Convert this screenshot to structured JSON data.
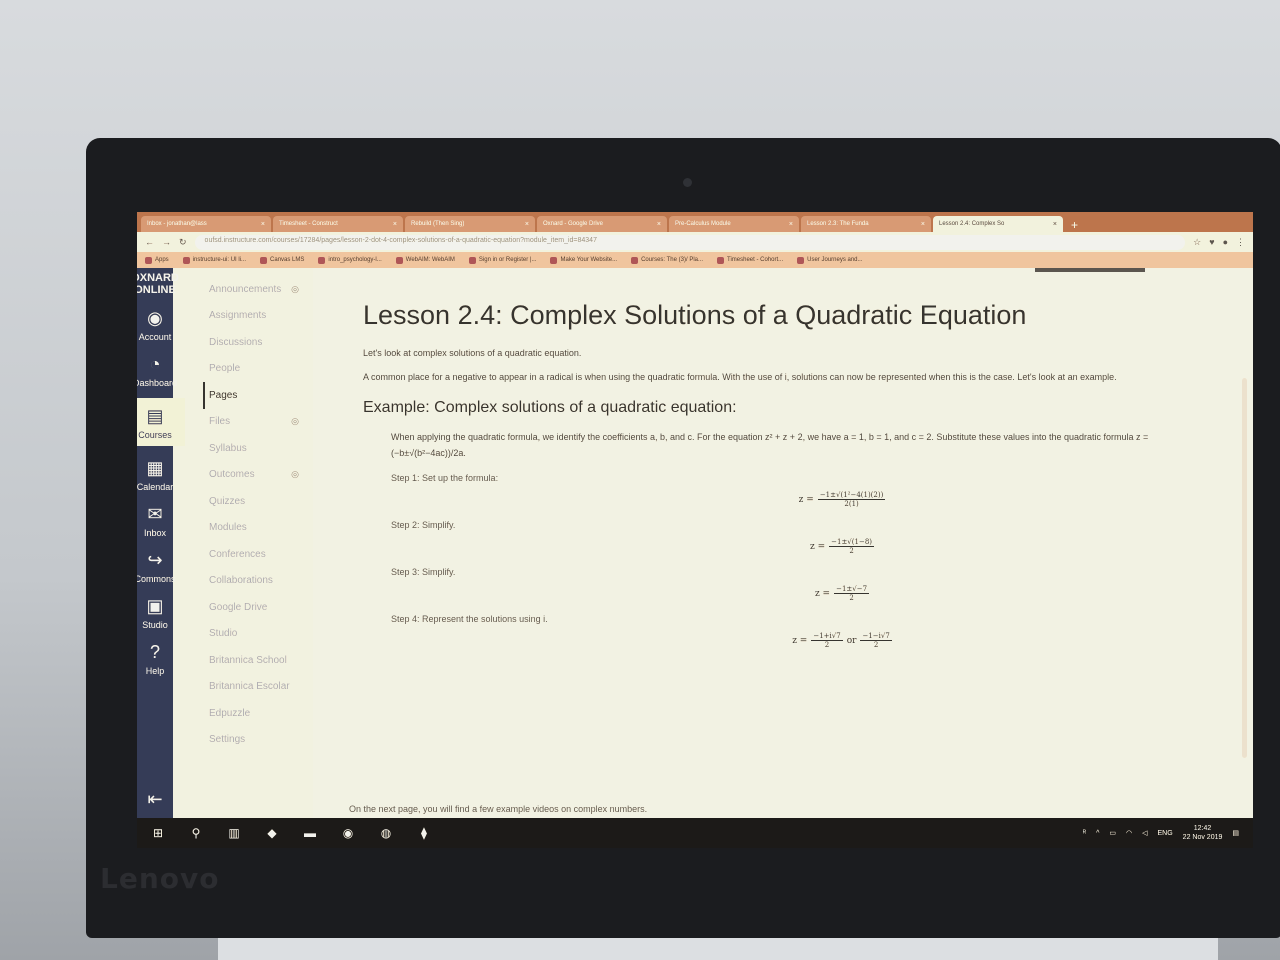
{
  "browser": {
    "tabs": [
      {
        "label": "Inbox - jonathan@lass",
        "active": false
      },
      {
        "label": "Timesheet - Construct",
        "active": false
      },
      {
        "label": "Rebuild (Then Sing)",
        "active": false
      },
      {
        "label": "Oxnard - Google Drive",
        "active": false
      },
      {
        "label": "Pre-Calculus Module",
        "active": false
      },
      {
        "label": "Lesson 2.3: The Funda",
        "active": false
      },
      {
        "label": "Lesson 2.4: Complex So",
        "active": true
      }
    ],
    "url": "oufsd.instructure.com/courses/17284/pages/lesson-2-dot-4-complex-solutions-of-a-quadratic-equation?module_item_id=84347",
    "bookmarks": [
      "Apps",
      "instructure-ui: UI li...",
      "Canvas LMS",
      "intro_psychology-l...",
      "WebAIM: WebAIM",
      "Sign in or Register |...",
      "Make Your Website...",
      "Courses: The (3)/ Pla...",
      "Timesheet - Cohort...",
      "User Journeys and..."
    ]
  },
  "global_nav": {
    "logo_line1": "OXNARD",
    "logo_line2": "ONLINE",
    "items": [
      {
        "label": "Account",
        "icon": "avatar-icon"
      },
      {
        "label": "Dashboard",
        "icon": "dashboard-icon"
      },
      {
        "label": "Courses",
        "icon": "book-icon"
      },
      {
        "label": "Calendar",
        "icon": "calendar-icon"
      },
      {
        "label": "Inbox",
        "icon": "inbox-icon"
      },
      {
        "label": "Commons",
        "icon": "commons-icon"
      },
      {
        "label": "Studio",
        "icon": "studio-icon"
      },
      {
        "label": "Help",
        "icon": "help-icon"
      }
    ]
  },
  "course_nav": {
    "items": [
      "Announcements",
      "Assignments",
      "Discussions",
      "People",
      "Pages",
      "Files",
      "Syllabus",
      "Outcomes",
      "Quizzes",
      "Modules",
      "Conferences",
      "Collaborations",
      "Google Drive",
      "Studio",
      "Britannica School",
      "Britannica Escolar",
      "Edpuzzle",
      "Settings"
    ]
  },
  "page": {
    "title": "Lesson 2.4: Complex Solutions of a Quadratic Equation",
    "intro": "Let's look at complex solutions of a quadratic equation.",
    "para": "A common place for a negative to appear in a radical is when using the quadratic formula. With the use of i, solutions can now be represented when this is the case. Let's look at an example.",
    "example_heading": "Example: Complex solutions of a quadratic equation:",
    "example_text": "When applying the quadratic formula, we identify the coefficients a, b, and c. For the equation z² + z + 2, we have a = 1, b = 1, and c = 2. Substitute these values into the quadratic formula z = (−b±√(b²−4ac))/2a.",
    "step1": "Step 1: Set up the formula:",
    "eq1_num": "−1±√(1²−4(1)(2))",
    "eq1_den": "2(1)",
    "step2": "Step 2: Simplify.",
    "eq2_num": "−1±√(1−8)",
    "eq2_den": "2",
    "step3": "Step 3: Simplify.",
    "eq3_num": "−1±√−7",
    "eq3_den": "2",
    "step4": "Step 4: Represent the solutions using i.",
    "eq4a_num": "−1+i√7",
    "eq4a_den": "2",
    "eq4_or": "or",
    "eq4b_num": "−1−i√7",
    "eq4b_den": "2",
    "z_eq": "z =",
    "footer": "On the next page, you will find a few example videos on complex numbers."
  },
  "taskbar": {
    "lang": "ENG",
    "time": "12:42",
    "date": "22 Nov 2019"
  },
  "device_brand": "Lenovo"
}
